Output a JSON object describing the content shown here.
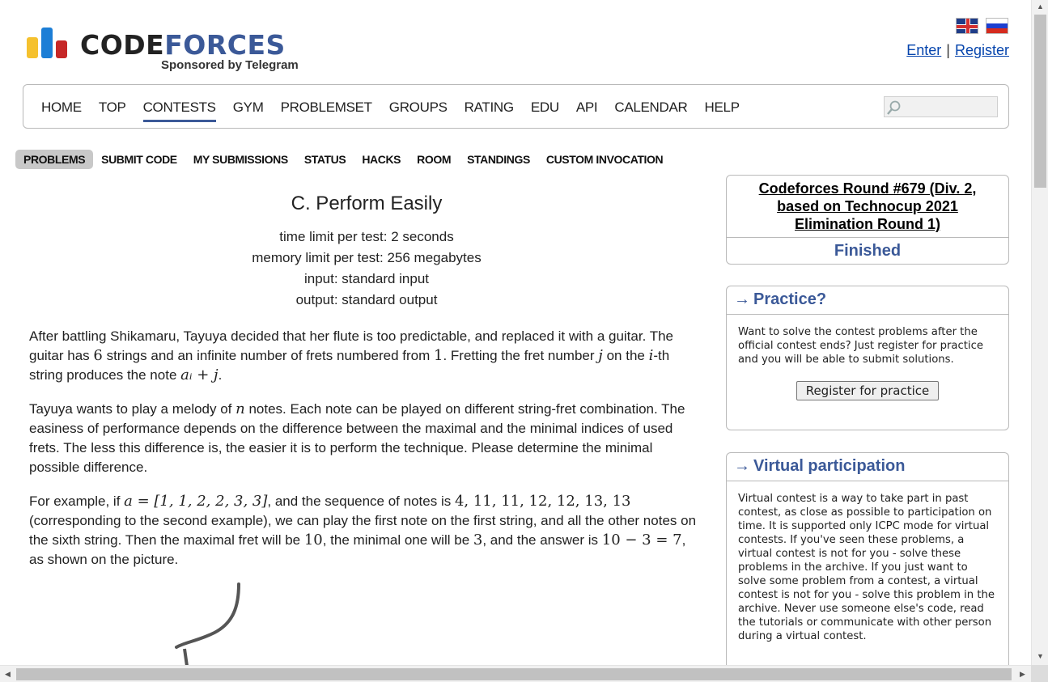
{
  "logo": {
    "code": "CODE",
    "forces": "FORCES",
    "sponsor": "Sponsored by Telegram"
  },
  "auth": {
    "enter": "Enter",
    "separator": "|",
    "register": "Register"
  },
  "menu": {
    "items": [
      "HOME",
      "TOP",
      "CONTESTS",
      "GYM",
      "PROBLEMSET",
      "GROUPS",
      "RATING",
      "EDU",
      "API",
      "CALENDAR",
      "HELP"
    ],
    "active": "CONTESTS",
    "search_placeholder": ""
  },
  "submenu": {
    "items": [
      "PROBLEMS",
      "SUBMIT CODE",
      "MY SUBMISSIONS",
      "STATUS",
      "HACKS",
      "ROOM",
      "STANDINGS",
      "CUSTOM INVOCATION"
    ],
    "active": "PROBLEMS"
  },
  "problem": {
    "title": "C. Perform Easily",
    "time_limit": "time limit per test: 2 seconds",
    "memory_limit": "memory limit per test: 256 megabytes",
    "input": "input: standard input",
    "output": "output: standard output",
    "p1": {
      "a": "After battling Shikamaru, Tayuya decided that her flute is too predictable, and replaced it with a guitar. The guitar has ",
      "m1": "6",
      "b": " strings and an infinite number of frets numbered from ",
      "m2": "1",
      "c": ". Fretting the fret number ",
      "m3": "j",
      "d": " on the ",
      "m4": "i",
      "e": "-th string produces the note ",
      "m5": "aᵢ + j",
      "f": "."
    },
    "p2": {
      "a": "Tayuya wants to play a melody of ",
      "m1": "n",
      "b": " notes. Each note can be played on different string-fret combination. The easiness of performance depends on the difference between the maximal and the minimal indices of used frets. The less this difference is, the easier it is to perform the technique. Please determine the minimal possible difference."
    },
    "p3": {
      "a": "For example, if ",
      "m1": "a = [1, 1, 2, 2, 3, 3]",
      "b": ", and the sequence of notes is ",
      "m2": "4, 11, 11, 12, 12, 13, 13",
      "c": " (corresponding to the second example), we can play the first note on the first string, and all the other notes on the sixth string. Then the maximal fret will be ",
      "m3": "10",
      "d": ", the minimal one will be ",
      "m4": "3",
      "e": ", and the answer is ",
      "m5": "10 − 3 = 7",
      "f": ", as shown on the picture."
    }
  },
  "sidebar": {
    "round": {
      "line1": "Codeforces Round #679 (Div. 2,",
      "line2": "based on Technocup 2021",
      "line3": "Elimination Round 1)",
      "status": "Finished"
    },
    "practice": {
      "arrow": "→",
      "title": "Practice?",
      "text": "Want to solve the contest problems after the official contest ends? Just register for practice and you will be able to submit solutions.",
      "button": "Register for practice"
    },
    "virtual": {
      "arrow": "→",
      "title": "Virtual participation",
      "text": "Virtual contest is a way to take part in past contest, as close as possible to participation on time. It is supported only ICPC mode for virtual contests. If you've seen these problems, a virtual contest is not for you - solve these problems in the archive. If you just want to solve some problem from a contest, a virtual contest is not for you - solve this problem in the archive. Never use someone else's code, read the tutorials or communicate with other person during a virtual contest."
    }
  },
  "colors": {
    "accent": "#3b5998",
    "link": "#0645ad",
    "logo_yellow": "#f5c12e",
    "logo_blue": "#1c7ed6",
    "logo_red": "#c62828"
  }
}
